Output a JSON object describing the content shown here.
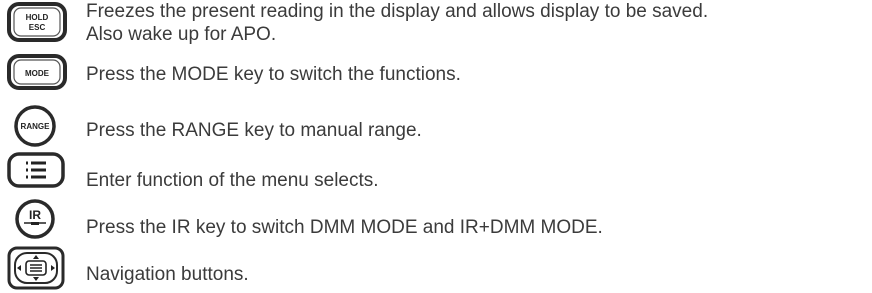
{
  "items": [
    {
      "key_label_line1": "HOLD",
      "key_label_line2": "ESC",
      "icon": "hold-esc-key-icon",
      "desc_line1": "Freezes the present reading in the display and allows display to be saved.",
      "desc_line2": "Also wake up for APO."
    },
    {
      "key_label": "MODE",
      "icon": "mode-key-icon",
      "desc": "Press the MODE key to switch the functions."
    },
    {
      "key_label": "RANGE",
      "icon": "range-key-icon",
      "desc": "Press the RANGE key to manual range."
    },
    {
      "key_label": "",
      "icon": "menu-key-icon",
      "desc": "Enter function of the menu selects."
    },
    {
      "key_label": "IR",
      "icon": "ir-key-icon",
      "desc": "Press the IR key to switch DMM MODE and IR+DMM MODE."
    },
    {
      "key_label": "",
      "icon": "navigation-buttons-icon",
      "desc": "Navigation buttons."
    }
  ]
}
